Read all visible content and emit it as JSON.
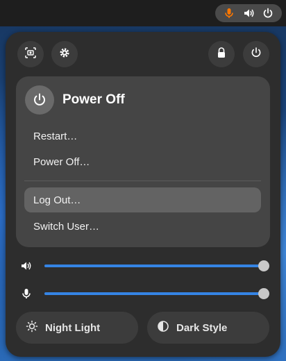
{
  "tray": {
    "icons": [
      "microphone-icon",
      "volume-icon",
      "power-icon"
    ],
    "mic_color": "#ff7800"
  },
  "quick_buttons": {
    "screenshot": "screenshot-icon",
    "settings": "gear-icon",
    "lock": "lock-icon",
    "power": "power-icon"
  },
  "power_menu": {
    "title": "Power Off",
    "items": [
      {
        "label": "Restart…"
      },
      {
        "label": "Power Off…"
      },
      {
        "label": "Log Out…",
        "active": true
      },
      {
        "label": "Switch User…"
      }
    ]
  },
  "sliders": {
    "volume": {
      "icon": "speaker-icon",
      "level": 1.0
    },
    "microphone": {
      "icon": "microphone-icon",
      "level": 1.0
    }
  },
  "toggles": {
    "night_light": {
      "label": "Night Light",
      "icon": "brightness-icon"
    },
    "dark_style": {
      "label": "Dark Style",
      "icon": "contrast-icon"
    }
  },
  "colors": {
    "accent": "#3584e4",
    "menu_bg": "#2d2d2d",
    "submenu_bg": "#454545"
  }
}
